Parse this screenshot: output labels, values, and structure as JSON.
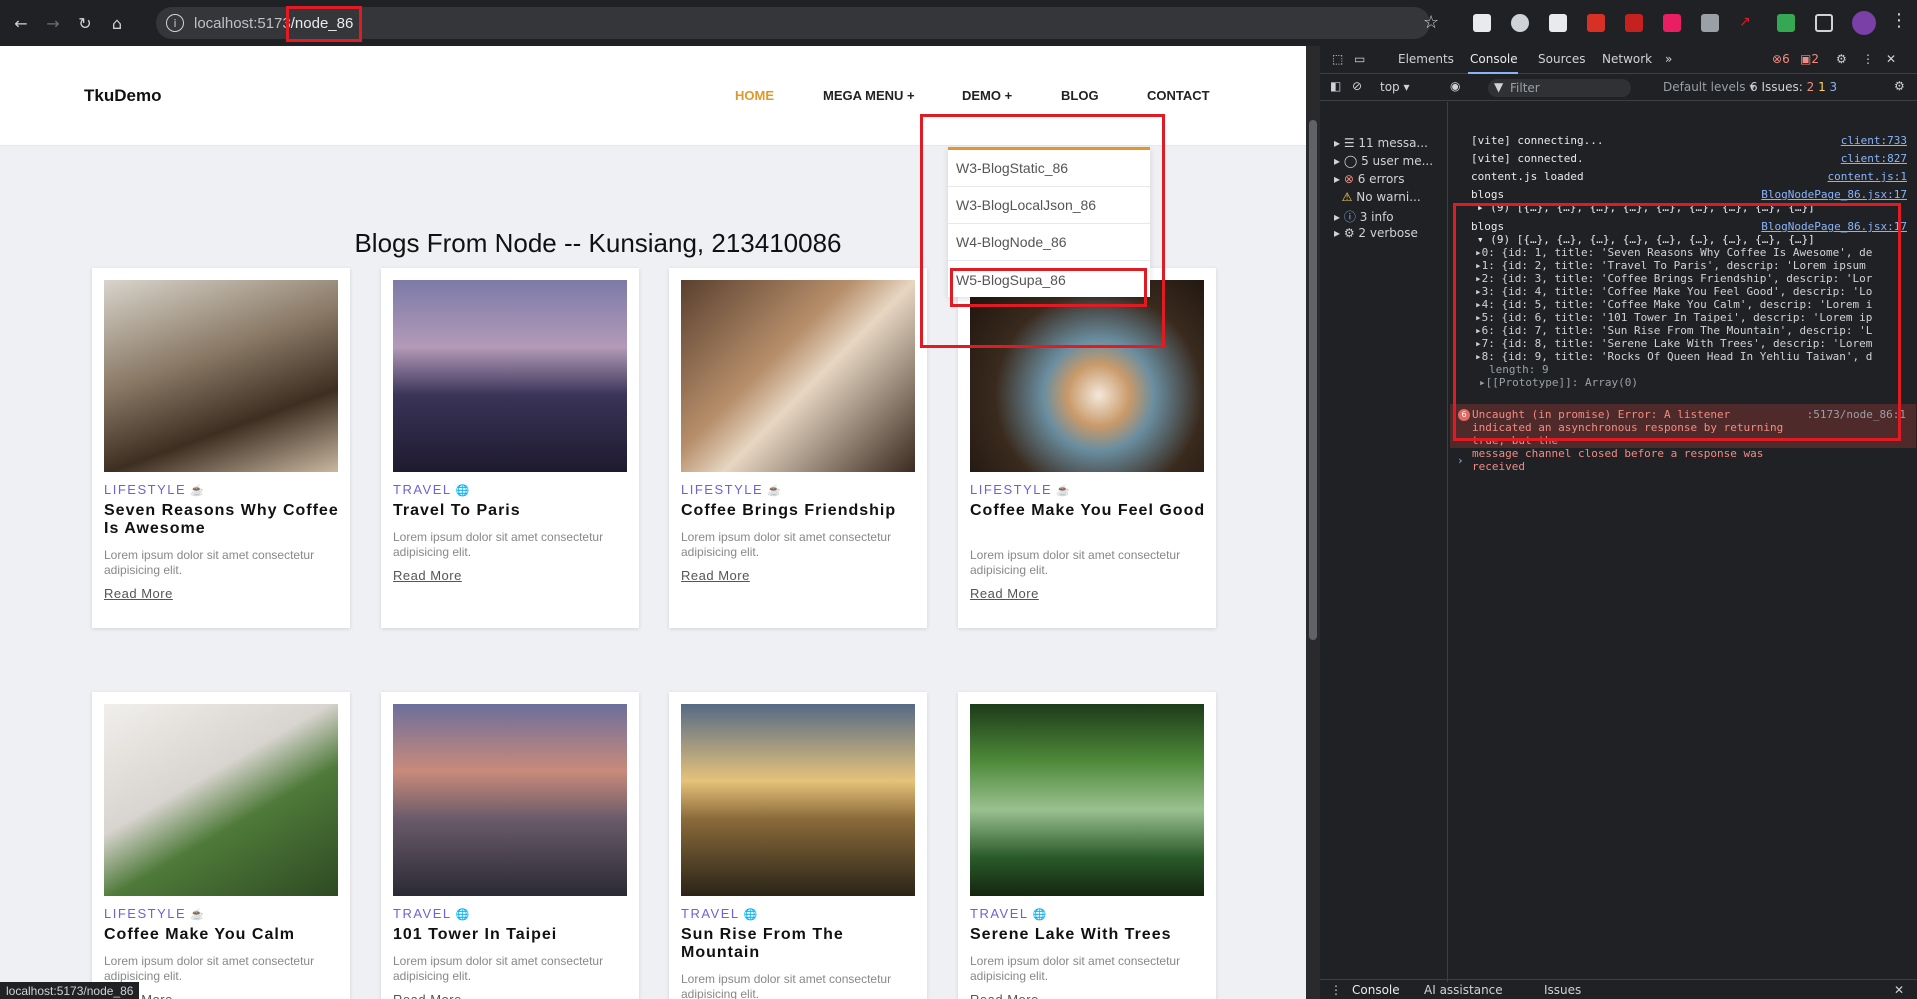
{
  "browser": {
    "url_host": "localhost:5173",
    "url_path": "/node_86",
    "status_url": "localhost:5173/node_86"
  },
  "site": {
    "logo": "TkuDemo",
    "menu": [
      "HOME",
      "MEGA MENU +",
      "DEMO +",
      "BLOG",
      "CONTACT"
    ],
    "dropdown": [
      "W3-BlogStatic_86",
      "W3-BlogLocalJson_86",
      "W4-BlogNode_86",
      "W5-BlogSupa_86"
    ],
    "title": "Blogs From Node -- Kunsiang, 213410086",
    "read_more": "Read More",
    "cards": [
      {
        "category": "LIFESTYLE",
        "title": "Seven Reasons Why Coffee Is Awesome",
        "desc": "Lorem ipsum dolor sit amet consectetur adipisicing elit."
      },
      {
        "category": "TRAVEL",
        "title": "Travel To Paris",
        "desc": "Lorem ipsum dolor sit amet consectetur adipisicing elit."
      },
      {
        "category": "LIFESTYLE",
        "title": "Coffee Brings Friendship",
        "desc": "Lorem ipsum dolor sit amet consectetur adipisicing elit."
      },
      {
        "category": "LIFESTYLE",
        "title": "Coffee Make You Feel Good",
        "desc": "Lorem ipsum dolor sit amet consectetur adipisicing elit."
      },
      {
        "category": "LIFESTYLE",
        "title": "Coffee Make You Calm",
        "desc": "Lorem ipsum dolor sit amet consectetur adipisicing elit."
      },
      {
        "category": "TRAVEL",
        "title": "101 Tower In Taipei",
        "desc": "Lorem ipsum dolor sit amet consectetur adipisicing elit."
      },
      {
        "category": "TRAVEL",
        "title": "Sun Rise From The Mountain",
        "desc": "Lorem ipsum dolor sit amet consectetur adipisicing elit."
      },
      {
        "category": "TRAVEL",
        "title": "Serene Lake With Trees",
        "desc": "Lorem ipsum dolor sit amet consectetur adipisicing elit."
      }
    ]
  },
  "devtools": {
    "tabs": [
      "Elements",
      "Console",
      "Sources",
      "Network"
    ],
    "error_count": "6",
    "warn_count": "2",
    "filter_placeholder": "Filter",
    "context": "top",
    "levels": "Default levels",
    "issues_label": "6 Issues:",
    "issues_counts": [
      "2",
      "1",
      "3"
    ],
    "sidebar": [
      "11 messa...",
      "5 user me...",
      "6 errors",
      "No warni...",
      "3 info",
      "2 verbose"
    ],
    "console_lines": [
      {
        "text": "[vite] connecting...",
        "src": "client:733"
      },
      {
        "text": "[vite] connected.",
        "src": "client:827"
      },
      {
        "text": "content.js loaded",
        "src": "content.js:1"
      },
      {
        "text": "blogs",
        "src": "BlogNodePage_86.jsx:17"
      },
      {
        "text": "▸ (9) [{…}, {…}, {…}, {…}, {…}, {…}, {…}, {…}, {…}]",
        "src": ""
      },
      {
        "text": "blogs",
        "src": "BlogNodePage_86.jsx:17"
      },
      {
        "text": "▾ (9) [{…}, {…}, {…}, {…}, {…}, {…}, {…}, {…}, {…}]",
        "src": ""
      }
    ],
    "objects": [
      "▸0: {id: 1, title: 'Seven Reasons Why Coffee Is Awesome', de",
      "▸1: {id: 2, title: 'Travel To Paris', descrip: 'Lorem ipsum",
      "▸2: {id: 3, title: 'Coffee Brings Friendship', descrip: 'Lor",
      "▸3: {id: 4, title: 'Coffee Make You Feel Good', descrip: 'Lo",
      "▸4: {id: 5, title: 'Coffee Make You Calm', descrip: 'Lorem i",
      "▸5: {id: 6, title: '101 Tower In Taipei', descrip: 'Lorem ip",
      "▸6: {id: 7, title: 'Sun Rise From The Mountain', descrip: 'L",
      "▸7: {id: 8, title: 'Serene Lake With Trees', descrip: 'Lorem",
      "▸8: {id: 9, title: 'Rocks Of Queen Head In Yehliu Taiwan', d",
      "length: 9",
      "▸[[Prototype]]: Array(0)"
    ],
    "error_text": "Uncaught (in promise) Error: A listener\nindicated an asynchronous response by returning true, but the\nmessage channel closed before a response was received",
    "error_src": ":5173/node_86:1",
    "bottom_tabs": [
      "Console",
      "AI assistance",
      "Issues"
    ]
  }
}
